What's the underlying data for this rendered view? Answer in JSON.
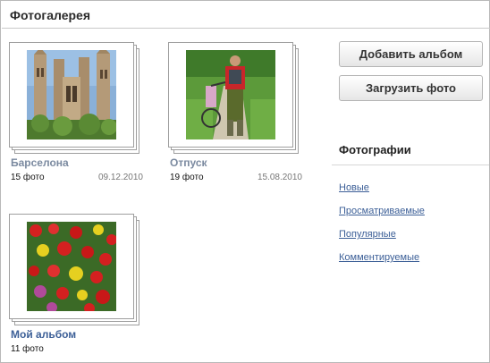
{
  "header": {
    "title": "Фотогалерея"
  },
  "albums": [
    {
      "name": "Барселона",
      "count": "15 фото",
      "date": "09.12.2010",
      "thumb_icon": "barcelona-cathedral-photo"
    },
    {
      "name": "Отпуск",
      "count": "19 фото",
      "date": "15.08.2010",
      "thumb_icon": "cyclist-photo"
    },
    {
      "name": "Мой альбом",
      "count": "11 фото",
      "date": "",
      "thumb_icon": "flowers-photo"
    }
  ],
  "actions": {
    "add_album": "Добавить альбом",
    "upload_photo": "Загрузить фото"
  },
  "sidebar": {
    "title": "Фотографии",
    "links": [
      "Новые",
      "Просматриваемые",
      "Популярные",
      "Комментируемые"
    ]
  },
  "colors": {
    "link": "#3c5f97",
    "inactive_album": "#7b8aa0",
    "border": "#b9b9b9"
  }
}
